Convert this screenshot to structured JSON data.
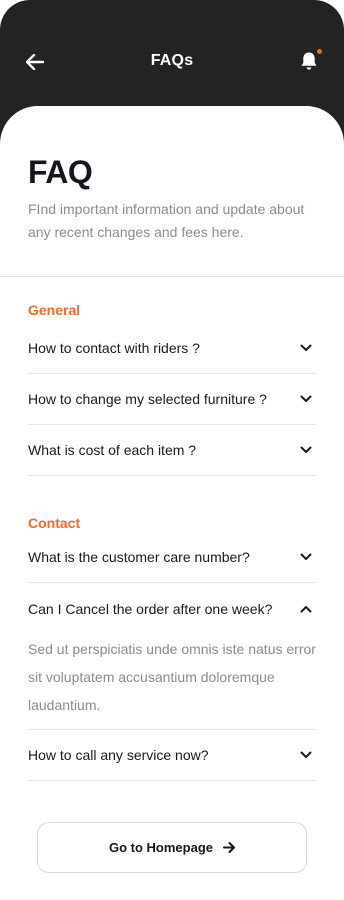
{
  "header": {
    "title": "FAQs",
    "back_icon": "arrow-left-icon",
    "notification_icon": "bell-icon",
    "notification_dot_color": "#f26a2a"
  },
  "intro": {
    "title": "FAQ",
    "subtitle": "FInd important information and update about any recent changes and fees here."
  },
  "sections": [
    {
      "label": "General",
      "items": [
        {
          "question": "How to contact with riders  ?",
          "expanded": false
        },
        {
          "question": "How to change my selected furniture ?",
          "expanded": false
        },
        {
          "question": "What is cost of each item ?",
          "expanded": false
        }
      ]
    },
    {
      "label": "Contact",
      "items": [
        {
          "question": "What is the customer care number?",
          "expanded": false
        },
        {
          "question": "Can I Cancel the order after one week?",
          "expanded": true,
          "answer": "Sed ut perspiciatis unde omnis iste natus error sit voluptatem accusantium doloremque laudantium."
        },
        {
          "question": "How to call any service now?",
          "expanded": false
        }
      ]
    }
  ],
  "footer": {
    "button_label": "Go to Homepage",
    "button_icon": "arrow-right-icon"
  },
  "colors": {
    "accent": "#f26a2a",
    "header_bg": "#232323",
    "text_primary": "#161621",
    "text_muted": "#8c8c8c"
  }
}
